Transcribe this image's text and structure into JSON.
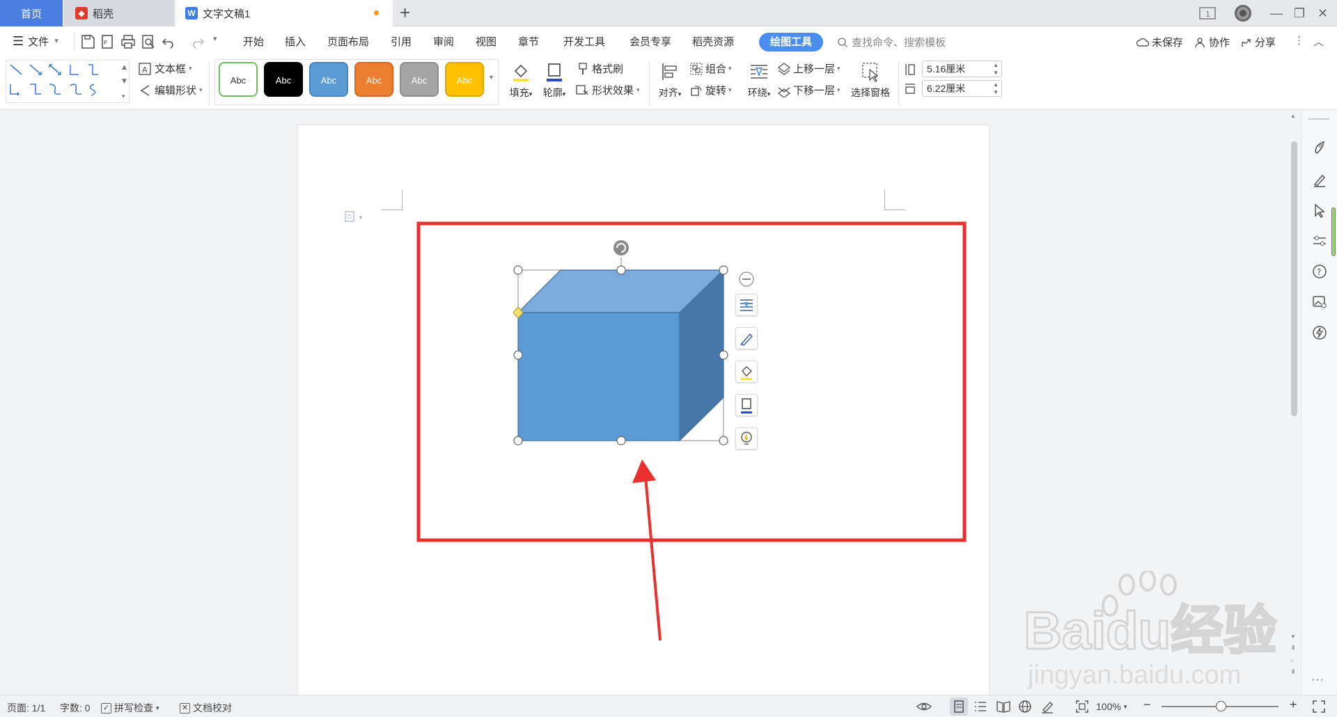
{
  "tabs": {
    "home": "首页",
    "daoke": "稻壳",
    "doc": "文字文稿1"
  },
  "menu": {
    "file": "文件",
    "items": [
      "开始",
      "插入",
      "页面布局",
      "引用",
      "审阅",
      "视图",
      "章节",
      "开发工具",
      "会员专享",
      "稻壳资源"
    ],
    "active_tab": "绘图工具",
    "search_placeholder": "查找命令、搜索模板",
    "unsaved": "未保存",
    "collab": "协作",
    "share": "分享"
  },
  "ribbon": {
    "textbox": "文本框",
    "edit_shape": "编辑形状",
    "style_label": "Abc",
    "styles": [
      {
        "bg": "#ffffff",
        "fg": "#333333",
        "border": "#6cbf5a"
      },
      {
        "bg": "#000000",
        "fg": "#ffffff",
        "border": "#000000"
      },
      {
        "bg": "#5b9bd5",
        "fg": "#ffffff",
        "border": "#4a85bd"
      },
      {
        "bg": "#ed7d31",
        "fg": "#ffffff",
        "border": "#d06a25"
      },
      {
        "bg": "#a5a5a5",
        "fg": "#ffffff",
        "border": "#8e8e8e"
      },
      {
        "bg": "#ffc000",
        "fg": "#ffffff",
        "border": "#e0a800"
      }
    ],
    "fill": "填充",
    "outline": "轮廓",
    "format_brush": "格式刷",
    "shape_effect": "形状效果",
    "align": "对齐",
    "group": "组合",
    "rotate": "旋转",
    "wrap": "环绕",
    "bring_forward": "上移一层",
    "send_backward": "下移一层",
    "selection_pane": "选择窗格",
    "height": "5.16厘米",
    "width": "6.22厘米"
  },
  "status": {
    "page": "页面: 1/1",
    "words": "字数: 0",
    "spell": "拼写检查",
    "proof": "文档校对",
    "zoom": "100%"
  },
  "watermark": {
    "brand": "Baidu经验",
    "url": "jingyan.baidu.com"
  },
  "colors": {
    "accent": "#4a8ff0",
    "home_tab": "#4a7fe0",
    "cube_front": "#5b9bd5",
    "cube_top": "#7aabdc",
    "cube_side": "#4677a8",
    "annotation_red": "#e8312f"
  }
}
